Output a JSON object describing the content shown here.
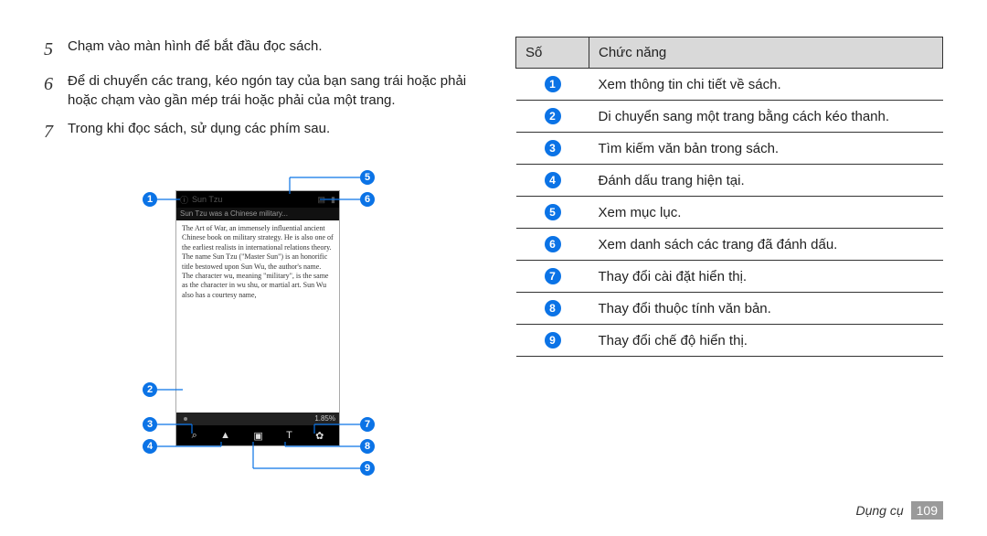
{
  "steps": [
    {
      "n": "5",
      "text": "Chạm vào màn hình để bắt đầu đọc sách."
    },
    {
      "n": "6",
      "text": "Để di chuyển các trang, kéo ngón tay của bạn sang trái hoặc phải hoặc chạm vào gần mép trái hoặc phải của một trang."
    },
    {
      "n": "7",
      "text": "Trong khi đọc sách, sử dụng các phím sau."
    }
  ],
  "phone": {
    "topbar_text": "Sun Tzu",
    "title_text": "Sun Tzu was a Chinese military...",
    "body_text": "The Art of War, an immensely influential ancient Chinese book on military strategy. He is also one of the earliest realists in international relations theory.\nThe name Sun Tzu (\"Master Sun\") is an honorific title bestowed upon Sun Wu, the author's name. The character wu, meaning \"military\", is the same as the character in wu shu, or martial art. Sun Wu also has a courtesy name,",
    "progress_text": "1.85%"
  },
  "table": {
    "head_num": "Số",
    "head_func": "Chức năng",
    "rows": [
      "Xem thông tin chi tiết về sách.",
      "Di chuyển sang một trang bằng cách kéo thanh.",
      "Tìm kiếm văn bản trong sách.",
      "Đánh dấu trang hiện tại.",
      "Xem mục lục.",
      "Xem danh sách các trang đã đánh dấu.",
      "Thay đổi cài đặt hiển thị.",
      "Thay đổi thuộc tính văn bản.",
      "Thay đổi chế độ hiển thị."
    ]
  },
  "callouts": [
    "1",
    "2",
    "3",
    "4",
    "5",
    "6",
    "7",
    "8",
    "9"
  ],
  "footer": {
    "label": "Dụng cụ",
    "page": "109"
  }
}
